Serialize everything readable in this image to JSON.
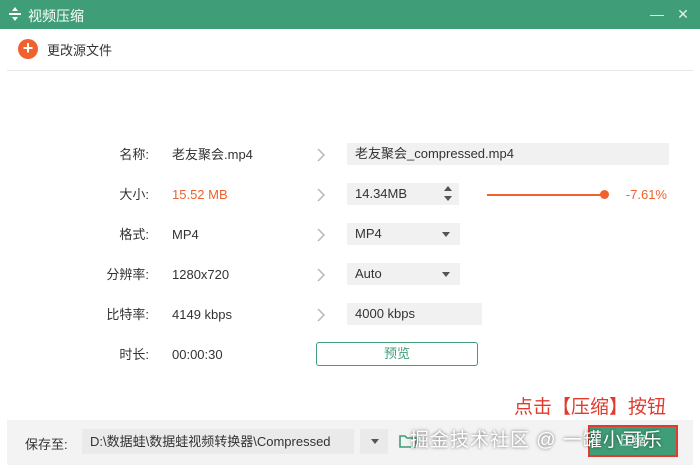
{
  "window": {
    "title": "视频压缩"
  },
  "toolbar": {
    "change_source_label": "更改源文件"
  },
  "rows": {
    "name": {
      "label": "名称:",
      "original": "老友聚会.mp4",
      "output": "老友聚会_compressed.mp4"
    },
    "size": {
      "label": "大小:",
      "original": "15.52 MB",
      "output": "14.34MB",
      "percent": "-7.61%",
      "slider_level": 1.0
    },
    "format": {
      "label": "格式:",
      "original": "MP4",
      "output": "MP4"
    },
    "resolution": {
      "label": "分辨率:",
      "original": "1280x720",
      "output": "Auto"
    },
    "bitrate": {
      "label": "比特率:",
      "original": "4149 kbps",
      "output": "4000 kbps"
    },
    "duration": {
      "label": "时长:",
      "original": "00:00:30"
    }
  },
  "preview_button": "预览",
  "annotation": "点击【压缩】按钮",
  "footer": {
    "save_label": "保存至:",
    "path": "D:\\数据蛙\\数据蛙视频转换器\\Compressed",
    "compress_label": "压缩"
  },
  "watermark": "掘金技术社区 @ 一罐小可乐",
  "colors": {
    "accent": "#3f9e77",
    "highlight": "#f0612d",
    "annotation": "#e23a2d"
  }
}
